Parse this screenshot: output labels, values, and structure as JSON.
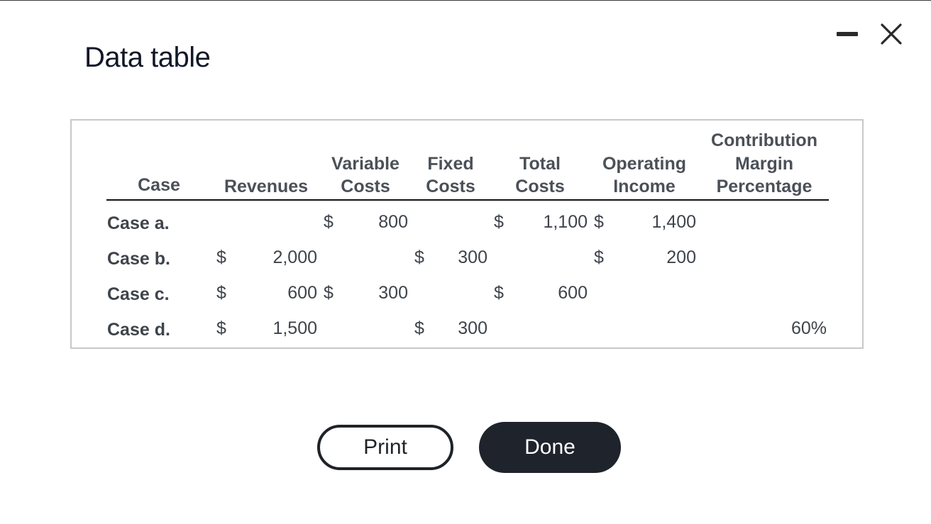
{
  "dialog": {
    "title": "Data table",
    "print_label": "Print",
    "done_label": "Done"
  },
  "table": {
    "headers": {
      "case": "Case",
      "revenues": "Revenues",
      "variable_costs": [
        "Variable",
        "Costs"
      ],
      "fixed_costs": [
        "Fixed",
        "Costs"
      ],
      "total_costs": [
        "Total",
        "Costs"
      ],
      "operating_income": [
        "Operating",
        "Income"
      ],
      "cm_percentage": [
        "Contribution",
        "Margin",
        "Percentage"
      ]
    },
    "currency": "$",
    "rows": [
      {
        "label": "Case a.",
        "revenues": "",
        "variable_costs": "800",
        "fixed_costs": "",
        "total_costs": "1,100",
        "operating_income": "1,400",
        "cm_percentage": ""
      },
      {
        "label": "Case b.",
        "revenues": "2,000",
        "variable_costs": "",
        "fixed_costs": "300",
        "total_costs": "",
        "operating_income": "200",
        "cm_percentage": ""
      },
      {
        "label": "Case c.",
        "revenues": "600",
        "variable_costs": "300",
        "fixed_costs": "",
        "total_costs": "600",
        "operating_income": "",
        "cm_percentage": ""
      },
      {
        "label": "Case d.",
        "revenues": "1,500",
        "variable_costs": "",
        "fixed_costs": "300",
        "total_costs": "",
        "operating_income": "",
        "cm_percentage": "60%"
      }
    ]
  }
}
